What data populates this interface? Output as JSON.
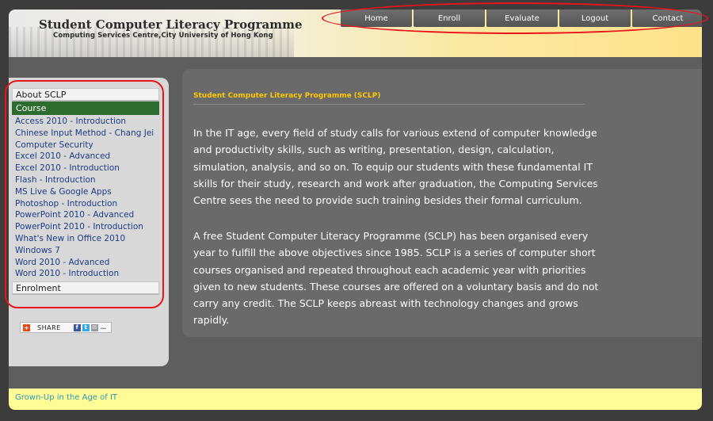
{
  "header": {
    "title": "Student Computer Literacy Programme",
    "subtitle": "Computing Services Centre,City University of Hong Kong"
  },
  "nav": {
    "items": [
      "Home",
      "Enroll",
      "Evaluate",
      "Logout",
      "Contact"
    ]
  },
  "sidebar": {
    "about_label": "About SCLP",
    "course_label": "Course",
    "courses": [
      "Access 2010 - Introduction",
      "Chinese Input Method - Chang Jei",
      "Computer Security",
      "Excel 2010 - Advanced",
      "Excel 2010 - Introduction",
      "Flash - Introduction",
      "MS Live & Google Apps",
      "Photoshop - Introduction",
      "PowerPoint 2010 - Advanced",
      "PowerPoint 2010 - Introduction",
      "What's New in Office 2010",
      "Windows 7",
      "Word 2010 - Advanced",
      "Word 2010 - Introduction"
    ],
    "enrolment_label": "Enrolment",
    "share_label": "SHARE"
  },
  "content": {
    "title": "Student Computer Literacy Programme (SCLP)",
    "paragraph1": "In the IT age, every field of study calls for various extend of computer knowledge and productivity skills, such as writing, presentation, design, calculation, simulation, analysis, and so on. To equip our students with these fundamental IT skills for their study, research and work after graduation, the Computing Services Centre sees the need to provide such training besides their formal curriculum.",
    "paragraph2": "A free Student Computer Literacy Programme (SCLP) has been organised every year to fulfill the above objectives since 1985. SCLP is a series of computer short courses organised and repeated throughout each academic year with priorities given to new students. These courses are offered on a voluntary basis and do not carry any credit. The SCLP keeps abreast with technology changes and grows rapidly."
  },
  "footer": {
    "tagline": "Grown-Up in the Age of IT"
  },
  "colors": {
    "annotation": "#e8141c",
    "course_link": "#1e3a86",
    "active_header": "#2e6b2e",
    "content_title": "#ffc800",
    "footer_text": "#2d97b6"
  }
}
